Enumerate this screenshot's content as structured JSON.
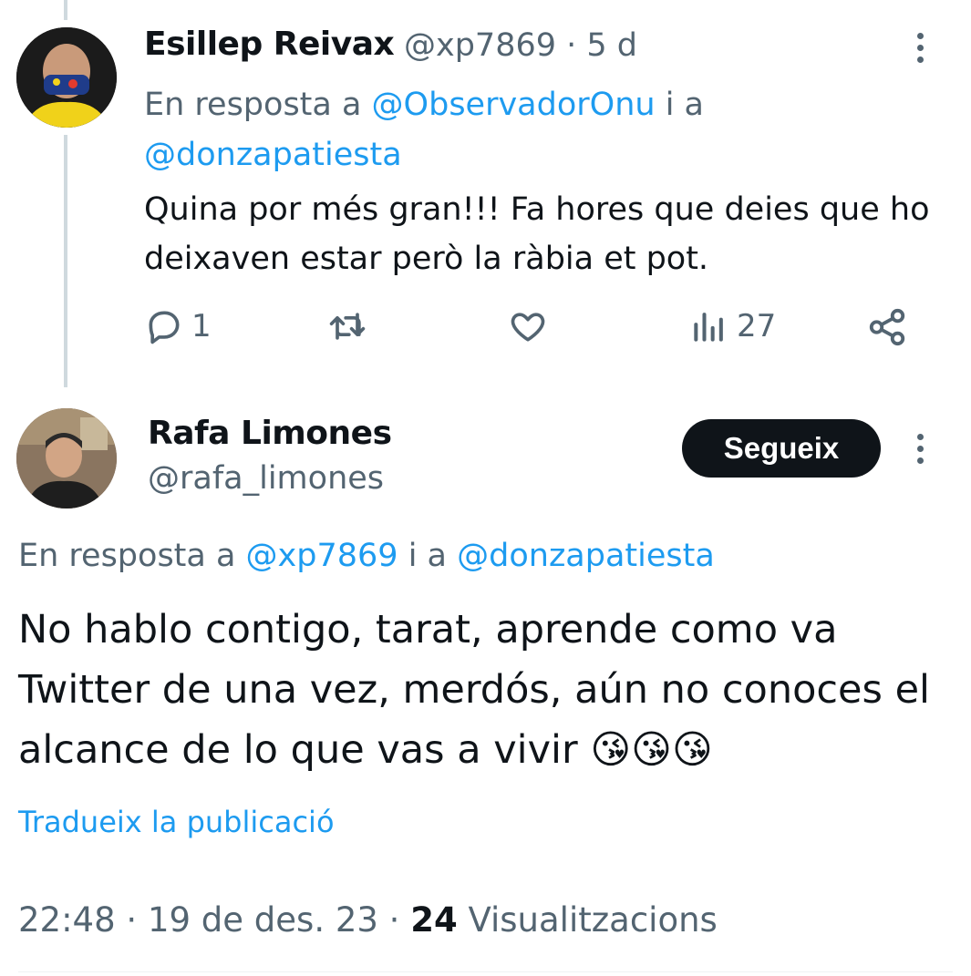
{
  "tweet1": {
    "author_name": "Esillep Reivax",
    "author_meta": "@xp7869 · 5 d",
    "reply_prefix": "En resposta a ",
    "reply_handle1": "@ObservadorOnu",
    "reply_join": " i a",
    "reply_handle2": "@donzapatiesta",
    "body": "Quina por més gran!!! Fa hores que deies que ho deixaven estar però la ràbia et pot.",
    "actions": {
      "reply_count": "1",
      "retweet_count": "",
      "like_count": "",
      "views_count": "27"
    }
  },
  "tweet2": {
    "author_name": "Rafa Limones",
    "author_handle": "@rafa_limones",
    "follow_label": "Segueix",
    "reply_prefix": "En resposta a ",
    "reply_handle1": "@xp7869",
    "reply_join": " i a ",
    "reply_handle2": "@donzapatiesta",
    "body": "No hablo contigo, tarat, aprende como va Twitter de una vez, merdós, aún no conoces el alcance de lo que vas a vivir 😘😘😘",
    "translate_label": "Tradueix la publicació",
    "time": "22:48",
    "date": "19 de des. 23",
    "views_count": "24",
    "views_label": "Visualitzacions"
  },
  "colors": {
    "text": "#0f1419",
    "secondary": "#536471",
    "link": "#1d9bf0",
    "button_bg": "#0f1419"
  },
  "icons": [
    "reply-icon",
    "retweet-icon",
    "like-icon",
    "views-icon",
    "share-icon",
    "more-icon"
  ]
}
